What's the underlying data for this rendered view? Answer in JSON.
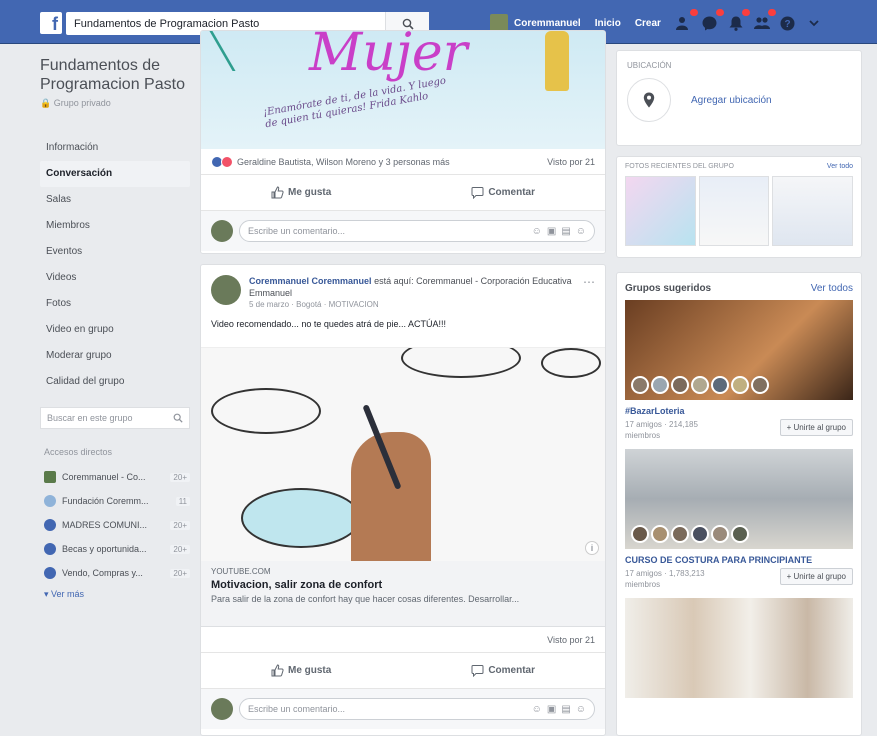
{
  "topbar": {
    "logo": "f",
    "search_value": "Fundamentos de Programacion Pasto",
    "user_name": "Coremmanuel",
    "home": "Inicio",
    "create": "Crear"
  },
  "colors": {
    "brand": "#4267b2",
    "badge": "#fa3e3e"
  },
  "sidebar": {
    "group_name": "Fundamentos de Programacion Pasto",
    "group_type": "Grupo privado",
    "menu": [
      {
        "label": "Información",
        "active": false
      },
      {
        "label": "Conversación",
        "active": true
      },
      {
        "label": "Salas",
        "active": false
      },
      {
        "label": "Miembros",
        "active": false
      },
      {
        "label": "Eventos",
        "active": false
      },
      {
        "label": "Videos",
        "active": false
      },
      {
        "label": "Fotos",
        "active": false
      },
      {
        "label": "Video en grupo",
        "active": false
      },
      {
        "label": "Moderar grupo",
        "active": false
      },
      {
        "label": "Calidad del grupo",
        "active": false
      }
    ],
    "search_placeholder": "Buscar en este grupo",
    "shortcuts_title": "Accesos directos",
    "shortcuts": [
      {
        "label": "Coremmanuel - Co...",
        "count": "20+"
      },
      {
        "label": "Fundación Coremm...",
        "count": "11"
      },
      {
        "label": "MADRES COMUNI...",
        "count": "20+"
      },
      {
        "label": "Becas y oportunida...",
        "count": "20+"
      },
      {
        "label": "Vendo, Compras y...",
        "count": "20+"
      }
    ],
    "see_more": "Ver más"
  },
  "post1": {
    "banner_title": "Mujer",
    "banner_quote": "¡Enamórate de ti, de la vida. Y luego de quien tú quieras! Frida Kahlo",
    "reactions_text": "Geraldine Bautista, Wilson Moreno y 3 personas más",
    "views": "Visto por 21",
    "like": "Me gusta",
    "comment": "Comentar",
    "comment_placeholder": "Escribe un comentario..."
  },
  "post2": {
    "author": "Coremmanuel Coremmanuel",
    "author_suffix": "está aquí: Coremmanuel - Corporación Educativa Emmanuel",
    "meta": "5 de marzo · Bogotá · MOTIVACION",
    "text": "Video recomendado... no te quedes atrá de pie... ACTÚA!!!",
    "link_domain": "YOUTUBE.COM",
    "link_title": "Motivacion, salir zona de confort",
    "link_desc": "Para salir de la zona de confort hay que hacer cosas diferentes. Desarrollar...",
    "views": "Visto por 21",
    "like": "Me gusta",
    "comment": "Comentar",
    "comment_placeholder": "Escribe un comentario..."
  },
  "right": {
    "location_label": "UBICACIÓN",
    "add_location": "Agregar ubicación",
    "photos_title": "FOTOS RECIENTES DEL GRUPO",
    "photos_seeall": "Ver todo",
    "suggested_title": "Grupos sugeridos",
    "suggested_seeall": "Ver todos",
    "groups": [
      {
        "name": "#BazarLoteria",
        "members": "17 amigos · 214,185 miembros",
        "join": "+ Unirte al grupo"
      },
      {
        "name": "CURSO DE COSTURA PARA PRINCIPIANTE",
        "members": "17 amigos · 1,783,213 miembros",
        "join": "+ Unirte al grupo"
      }
    ]
  }
}
